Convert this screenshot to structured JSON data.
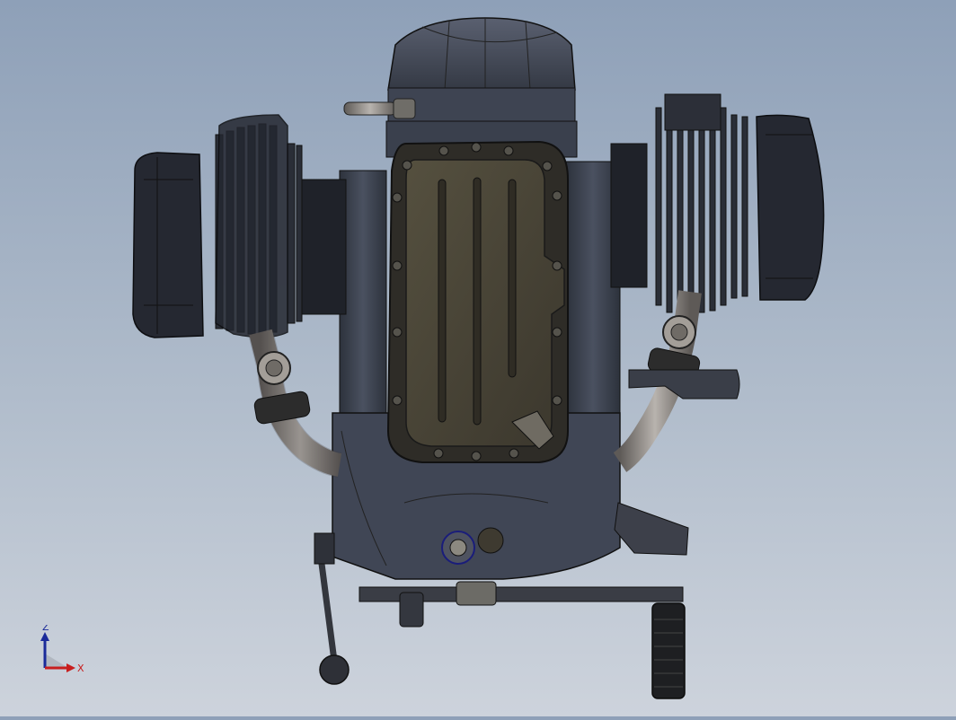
{
  "viewport": {
    "model": "boxer-engine-assembly",
    "view": "bottom"
  },
  "triad": {
    "z_label": "Z",
    "x_label": "X",
    "z_color": "#1a2a9a",
    "x_color": "#c81e1e"
  },
  "colors": {
    "background_top": "#8ea0b8",
    "background_bottom": "#cdd3dc",
    "body": "#3c4250",
    "body_dark": "#262a33",
    "pan": "#4a4538",
    "pipe": "#8e8a86",
    "edge": "#101216"
  }
}
